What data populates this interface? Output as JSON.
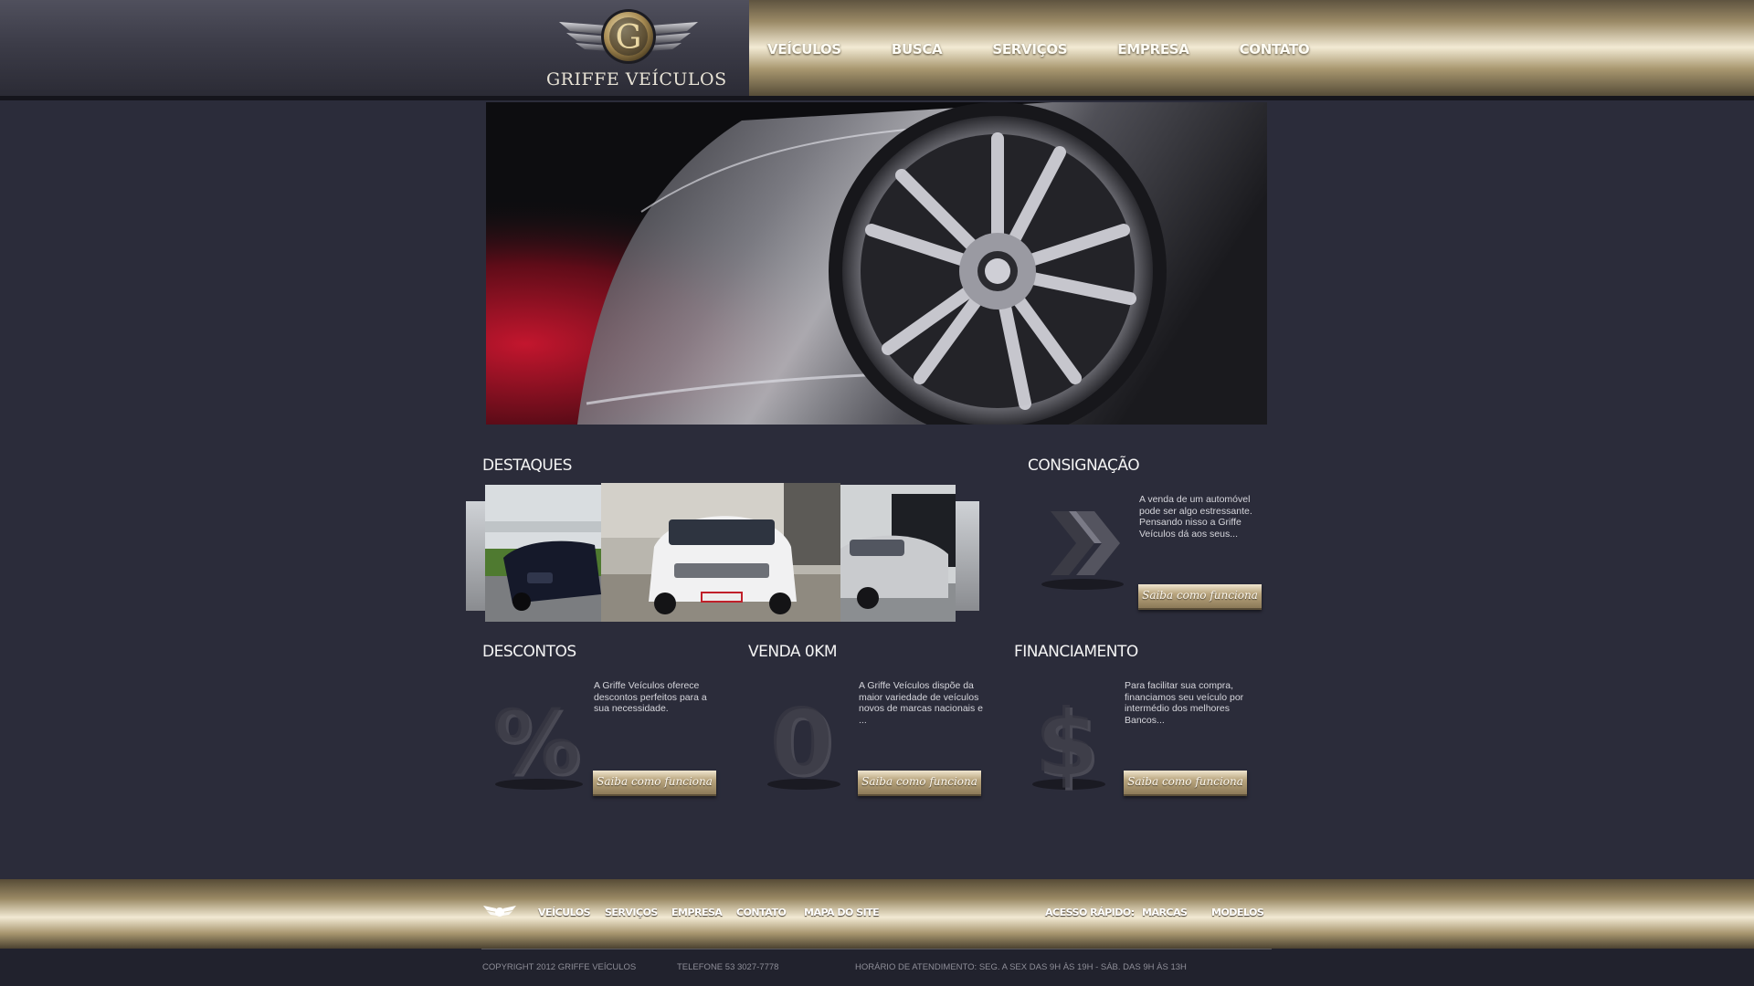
{
  "brand": {
    "name": "GRIFFE VEÍCULOS",
    "logo_letter": "G"
  },
  "nav": [
    "VEÍCULOS",
    "BUSCA",
    "SERVIÇOS",
    "EMPRESA",
    "CONTATO"
  ],
  "colors": {
    "background": "#2b2c3a",
    "gold": "#b9a57e",
    "dark_header": "#3c3c48"
  },
  "sections": {
    "destaques": {
      "title": "DESTAQUES",
      "items": [
        "bmw-x6-black",
        "vw-tiguan-white",
        "silver-sedan"
      ]
    },
    "consignacao": {
      "title": "CONSIGNAÇÃO",
      "text": "A venda de um automóvel pode ser algo estressante. Pensando nisso a Griffe Veículos dá aos seus...",
      "button": "Saiba como funciona",
      "icon": "chevrons-icon"
    },
    "descontos": {
      "title": "DESCONTOS",
      "text": "A Griffe Veículos oferece descontos perfeitos para a sua necessidade.",
      "button": "Saiba como funciona",
      "icon": "percent-icon"
    },
    "venda0km": {
      "title": "VENDA 0KM",
      "text": "A Griffe Veículos dispõe da maior variedade de veículos novos de marcas nacionais e ...",
      "button": "Saiba como funciona",
      "icon": "zero-icon"
    },
    "financiamento": {
      "title": "FINANCIAMENTO",
      "text": "Para facilitar sua compra, financiamos seu veículo por intermédio dos melhores Bancos...",
      "button": "Saiba como funciona",
      "icon": "dollar-icon"
    }
  },
  "footer": {
    "nav": [
      "VEÍCULOS",
      "SERVIÇOS",
      "EMPRESA",
      "CONTATO",
      "MAPA DO SITE"
    ],
    "quick_label": "ACESSO RÁPIDO:",
    "quick_links": [
      "MARCAS",
      "MODELOS"
    ],
    "copyright": "COPYRIGHT 2012 GRIFFE VEÍCULOS",
    "phone": "TELEFONE 53 3027-7778",
    "hours": "HORÁRIO DE ATENDIMENTO: SEG. A SEX DAS 9H ÀS 19H - SÁB. DAS 9H ÀS 13H"
  }
}
